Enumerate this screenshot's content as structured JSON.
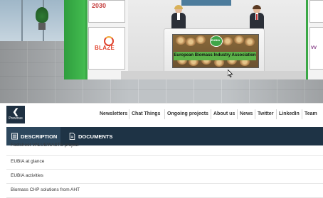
{
  "booth": {
    "poster_top_text": "2030",
    "blaze_logo": "BLAZE",
    "right_poster_text": "VV",
    "desk_banner_badge": "EUBIA",
    "desk_banner_title": "European Biomass Industry Association"
  },
  "navigation": {
    "previous_label": "Previous",
    "items": [
      "Newsletters",
      "Chat Things",
      "Ongoing projects",
      "About us",
      "News",
      "Twitter",
      "LinkedIn",
      "Team"
    ]
  },
  "tabs": {
    "description_label": "DESCRIPTION",
    "documents_label": "DOCUMENTS"
  },
  "documents": [
    "Factsheet VALUEWASTE project",
    "EUBIA at glance",
    "EUBIA activities",
    "Biomass CHP solutions from AHT"
  ],
  "colors": {
    "nav_dark": "#1e3345",
    "tab_active": "#2d475d",
    "booth_green": "#3ba847"
  }
}
